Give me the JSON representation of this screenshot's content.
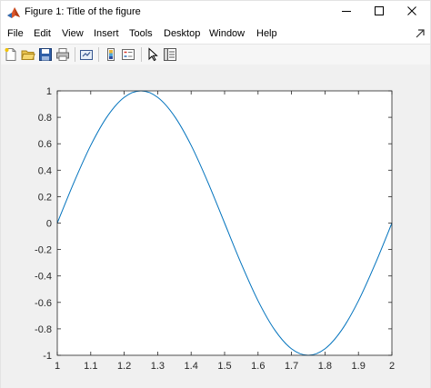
{
  "window": {
    "title": "Figure 1: Title of the figure",
    "controls": {
      "minimize": "minimize",
      "maximize": "maximize",
      "close": "close"
    }
  },
  "menubar": {
    "items": [
      "File",
      "Edit",
      "View",
      "Insert",
      "Tools",
      "Desktop",
      "Window",
      "Help"
    ]
  },
  "toolbar": {
    "buttons": [
      {
        "icon": "new-figure-icon"
      },
      {
        "icon": "open-file-icon"
      },
      {
        "icon": "save-icon"
      },
      {
        "icon": "print-icon"
      },
      {
        "icon": "link-plot-icon"
      },
      {
        "icon": "insert-colorbar-icon"
      },
      {
        "icon": "insert-legend-icon"
      },
      {
        "icon": "edit-plot-icon"
      },
      {
        "icon": "property-inspector-icon"
      }
    ]
  },
  "colors": {
    "line": "#0072bd",
    "axes_bg": "#ffffff",
    "figure_bg": "#f0f0f0",
    "axis": "#262626"
  },
  "chart_data": {
    "type": "line",
    "title": "",
    "xlabel": "",
    "ylabel": "",
    "xlim": [
      1,
      2
    ],
    "ylim": [
      -1,
      1
    ],
    "grid": false,
    "legend": "none",
    "xticks": [
      1,
      1.1,
      1.2,
      1.3,
      1.4,
      1.5,
      1.6,
      1.7,
      1.8,
      1.9,
      2
    ],
    "xtick_labels": [
      "1",
      "1.1",
      "1.2",
      "1.3",
      "1.4",
      "1.5",
      "1.6",
      "1.7",
      "1.8",
      "1.9",
      "2"
    ],
    "yticks": [
      -1,
      -0.8,
      -0.6,
      -0.4,
      -0.2,
      0,
      0.2,
      0.4,
      0.6,
      0.8,
      1
    ],
    "ytick_labels": [
      "-1",
      "-0.8",
      "-0.6",
      "-0.4",
      "-0.2",
      "0",
      "0.2",
      "0.4",
      "0.6",
      "0.8",
      "1"
    ],
    "series": [
      {
        "x": [
          1,
          1.05,
          1.1,
          1.15,
          1.2,
          1.25,
          1.3,
          1.35,
          1.4,
          1.45,
          1.5,
          1.55,
          1.6,
          1.65,
          1.7,
          1.75,
          1.8,
          1.85,
          1.9,
          1.95,
          2
        ],
        "y": [
          0,
          0.309,
          0.588,
          0.809,
          0.951,
          1,
          0.951,
          0.809,
          0.588,
          0.309,
          0,
          -0.309,
          -0.588,
          -0.809,
          -0.951,
          -1,
          -0.951,
          -0.809,
          -0.588,
          -0.309,
          0
        ]
      }
    ]
  }
}
